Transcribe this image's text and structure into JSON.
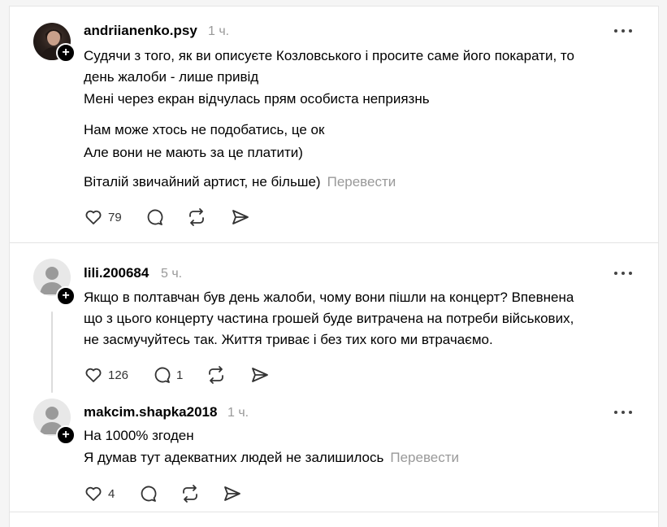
{
  "posts": [
    {
      "username": "andriianenko.psy",
      "time": "1 ч.",
      "lines": [
        "Судячи з того, як ви описуєте Козловського і просите саме його покарати, то",
        "день жалоби - лише привід",
        "Мені через екран відчулась прям особиста неприязнь",
        "Нам може хтось не подобатись, це ок",
        "Але вони не мають за це платити)",
        "Віталій звичайний артист, не більше)"
      ],
      "translate": "Перевести",
      "likes": "79",
      "replies": ""
    },
    {
      "username": "lili.200684",
      "time": "5 ч.",
      "lines": [
        "Якщо в полтавчан був день жалоби, чому вони пішли на концерт? Впевнена",
        "що з цього концерту частина грошей буде витрачена на потреби військових,",
        "не засмучуйтесь так. Життя триває і без тих кого ми втрачаємо."
      ],
      "translate": "",
      "likes": "126",
      "replies": "1"
    },
    {
      "username": "makcim.shapka2018",
      "time": "1 ч.",
      "lines": [
        "На 1000% згоден",
        "Я думав тут адекватних людей не залишилось"
      ],
      "translate": "Перевести",
      "likes": "4",
      "replies": ""
    }
  ],
  "icons": {
    "like": "heart-icon",
    "reply": "comment-icon",
    "repost": "repost-icon",
    "share": "share-icon",
    "more": "more-icon",
    "follow": "plus-icon"
  },
  "colors": {
    "muted": "#999999",
    "divider": "#e3e3e3",
    "text": "#000000"
  }
}
